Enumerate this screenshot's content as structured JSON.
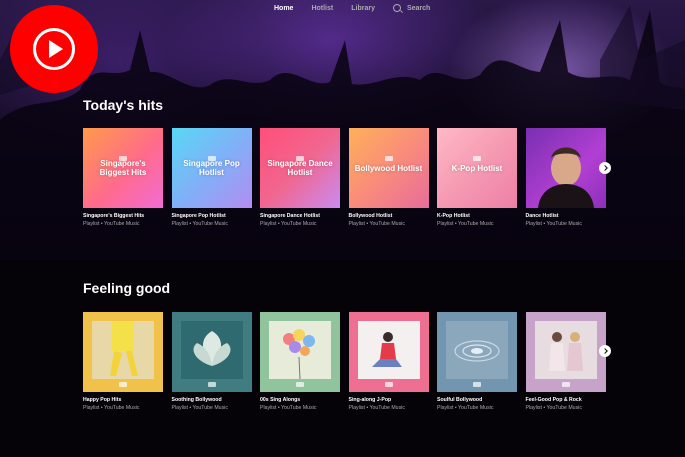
{
  "nav": {
    "items": [
      {
        "label": "Home",
        "active": true
      },
      {
        "label": "Hotlist",
        "active": false
      },
      {
        "label": "Library",
        "active": false
      }
    ],
    "search_label": "Search"
  },
  "sections": [
    {
      "title": "Today's hits",
      "cards": [
        {
          "overlay": "Singapore's Biggest Hits",
          "title": "Singapore's Biggest Hits",
          "subtitle": "Playlist • YouTube Music"
        },
        {
          "overlay": "Singapore Pop Hotlist",
          "title": "Singapore Pop Hotlist",
          "subtitle": "Playlist • YouTube Music"
        },
        {
          "overlay": "Singapore Dance Hotlist",
          "title": "Singapore Dance Hotlist",
          "subtitle": "Playlist • YouTube Music"
        },
        {
          "overlay": "Bollywood Hotlist",
          "title": "Bollywood Hotlist",
          "subtitle": "Playlist • YouTube Music"
        },
        {
          "overlay": "K-Pop Hotlist",
          "title": "K-Pop Hotlist",
          "subtitle": "Playlist • YouTube Music"
        },
        {
          "overlay": "",
          "title": "Dance Hotlist",
          "subtitle": "Playlist • YouTube Music"
        }
      ]
    },
    {
      "title": "Feeling good",
      "cards": [
        {
          "title": "Happy Pop Hits",
          "subtitle": "Playlist • YouTube Music"
        },
        {
          "title": "Soothing Bollywood",
          "subtitle": "Playlist • YouTube Music"
        },
        {
          "title": "00s Sing Alongs",
          "subtitle": "Playlist • YouTube Music"
        },
        {
          "title": "Sing-along J-Pop",
          "subtitle": "Playlist • YouTube Music"
        },
        {
          "title": "Soulful Bollywood",
          "subtitle": "Playlist • YouTube Music"
        },
        {
          "title": "Feel-Good Pop & Rock",
          "subtitle": "Playlist • YouTube Music"
        }
      ]
    }
  ],
  "icons": {
    "logo": "youtube-music-logo",
    "search": "search-icon",
    "next": "chevron-right-icon"
  },
  "colors": {
    "brand": "#ff0000",
    "background": "#050308"
  }
}
